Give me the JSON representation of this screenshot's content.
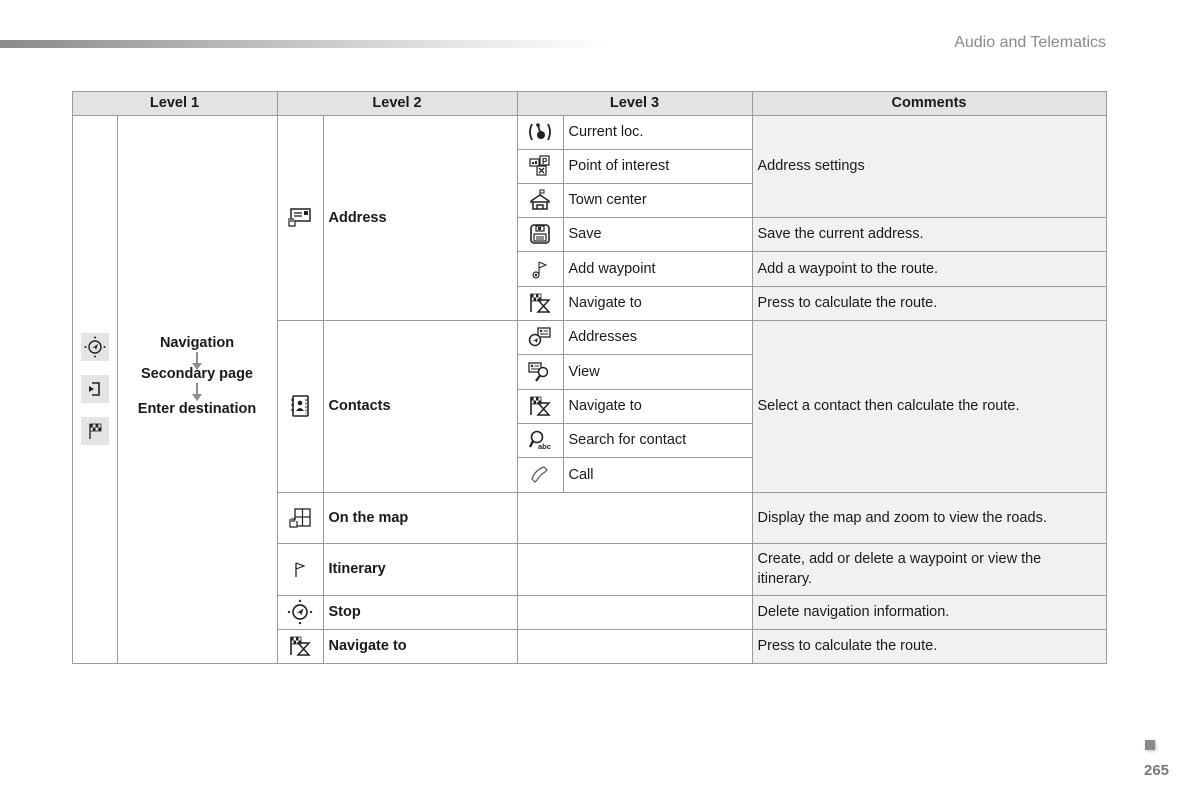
{
  "page": {
    "section_title": "Audio and Telematics",
    "page_number": "265"
  },
  "table": {
    "headers": [
      "Level 1",
      "Level 2",
      "Level 3",
      "Comments"
    ],
    "level1": {
      "icons": [
        "navigation-compass-icon",
        "secondary-page-icon",
        "checkered-flag-icon"
      ],
      "steps": [
        "Navigation",
        "Secondary page",
        "Enter destination"
      ]
    },
    "level2": [
      {
        "icon": "address-card-hand-icon",
        "label": "Address"
      },
      {
        "icon": "contacts-book-icon",
        "label": "Contacts"
      },
      {
        "icon": "map-hand-icon",
        "label": "On the map"
      },
      {
        "icon": "flag-icon",
        "label": "Itinerary"
      },
      {
        "icon": "navigation-compass-icon",
        "label": "Stop"
      },
      {
        "icon": "navigate-to-icon",
        "label": "Navigate to"
      }
    ],
    "level3": [
      {
        "icon": "current-location-icon",
        "label": "Current loc."
      },
      {
        "icon": "point-of-interest-icon",
        "label": "Point of interest"
      },
      {
        "icon": "town-center-icon",
        "label": "Town center"
      },
      {
        "icon": "save-floppy-icon",
        "label": "Save"
      },
      {
        "icon": "add-waypoint-icon",
        "label": "Add waypoint"
      },
      {
        "icon": "navigate-to-icon",
        "label": "Navigate to"
      },
      {
        "icon": "addresses-icon",
        "label": "Addresses"
      },
      {
        "icon": "view-contact-icon",
        "label": "View"
      },
      {
        "icon": "navigate-to-icon",
        "label": "Navigate to"
      },
      {
        "icon": "search-contact-icon",
        "label": "Search for contact"
      },
      {
        "icon": "call-phone-icon",
        "label": "Call"
      }
    ],
    "comments": [
      "Address settings",
      "Save the current address.",
      "Add a waypoint to the route.",
      "Press to calculate the route.",
      "Select a contact then calculate the route.",
      "Display the map and zoom to view the roads.",
      "Create, add or delete a waypoint or view the itinerary.",
      "Delete navigation information.",
      "Press to calculate the route."
    ]
  }
}
